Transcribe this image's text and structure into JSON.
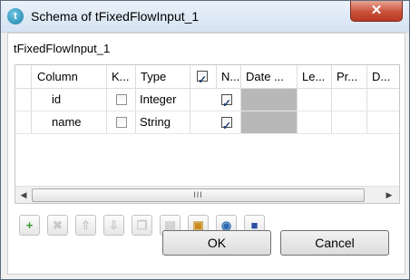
{
  "window": {
    "title": "Schema of tFixedFlowInput_1",
    "close_label": "✕",
    "app_icon_glyph": "t"
  },
  "schema": {
    "name": "tFixedFlowInput_1",
    "columns": [
      "Column",
      "K...",
      "Type",
      "",
      "N...",
      "Date ...",
      "Le...",
      "Pr...",
      "D..."
    ],
    "header_nullable_checked": true,
    "rows": [
      {
        "name": "id",
        "key": false,
        "type": "Integer",
        "nullable": true
      },
      {
        "name": "name",
        "key": false,
        "type": "String",
        "nullable": true
      }
    ]
  },
  "scrollbar": {
    "left_arrow": "◀",
    "right_arrow": "▶",
    "thumb_grip": "III"
  },
  "toolbar": {
    "buttons": [
      {
        "name": "add-row-button",
        "glyph": "+",
        "enabled": true,
        "color": "#3a9a2e"
      },
      {
        "name": "remove-row-button",
        "glyph": "✖",
        "enabled": false,
        "color": "#c8c8c8"
      },
      {
        "name": "move-up-button",
        "glyph": "⇧",
        "enabled": false,
        "color": "#c8c8c8"
      },
      {
        "name": "move-down-button",
        "glyph": "⇩",
        "enabled": false,
        "color": "#c8c8c8"
      },
      {
        "name": "copy-button",
        "glyph": "❐",
        "enabled": false,
        "color": "#c8c8c8"
      },
      {
        "name": "paste-button",
        "glyph": "▤",
        "enabled": false,
        "color": "#c8c8c8"
      },
      {
        "name": "import-schema-button",
        "glyph": "▣",
        "enabled": true,
        "color": "#c98a1c"
      },
      {
        "name": "export-schema-button",
        "glyph": "◉",
        "enabled": true,
        "color": "#2d6bb0"
      },
      {
        "name": "save-schema-button",
        "glyph": "■",
        "enabled": true,
        "color": "#2a4fa3"
      }
    ]
  },
  "buttons": {
    "ok": "OK",
    "cancel": "Cancel"
  }
}
